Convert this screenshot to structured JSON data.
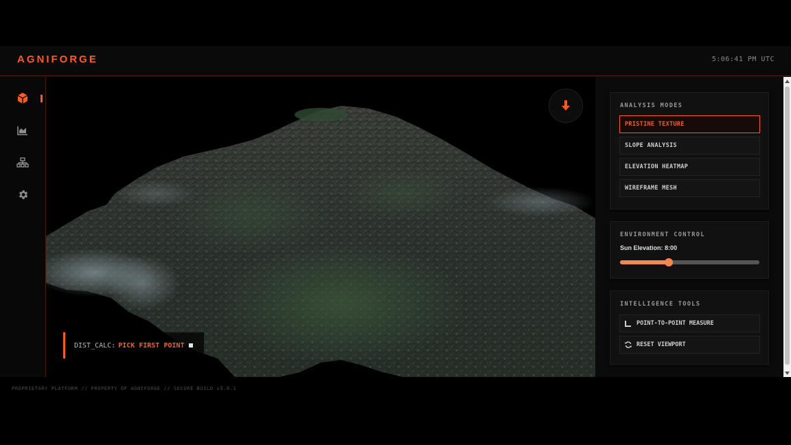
{
  "header": {
    "brand": "AGNIFORGE",
    "clock": "5:06:41 PM UTC"
  },
  "sidebar": {
    "items": [
      {
        "icon": "cube-icon",
        "active": true
      },
      {
        "icon": "area-chart-icon",
        "active": false
      },
      {
        "icon": "network-icon",
        "active": false
      },
      {
        "icon": "gear-icon",
        "active": false
      }
    ]
  },
  "viewport": {
    "download_icon": "arrow-down-icon",
    "dist_calc": {
      "label": "DIST_CALC:",
      "status": "PICK FIRST POINT"
    }
  },
  "analysis": {
    "title": "ANALYSIS MODES",
    "modes": [
      {
        "label": "PRISTINE TEXTURE",
        "active": true
      },
      {
        "label": "SLOPE ANALYSIS",
        "active": false
      },
      {
        "label": "ELEVATION HEATMAP",
        "active": false
      },
      {
        "label": "WIREFRAME MESH",
        "active": false
      }
    ]
  },
  "environment": {
    "title": "ENVIRONMENT CONTROL",
    "sun_label": "Sun Elevation: 8:00",
    "sun_fraction": 0.35
  },
  "tools": {
    "title": "INTELLIGENCE TOOLS",
    "items": [
      {
        "label": "POINT-TO-POINT MEASURE",
        "icon": "ruler-corner-icon"
      },
      {
        "label": "RESET VIEWPORT",
        "icon": "refresh-icon"
      }
    ]
  },
  "footer": {
    "text": "PROPRIETARY PLATFORM // PROPERTY OF AGNIFORGE // SECURE BUILD v3.0.1"
  },
  "colors": {
    "accent": "#ff5a1f",
    "background": "#070707",
    "card": "#111111"
  }
}
